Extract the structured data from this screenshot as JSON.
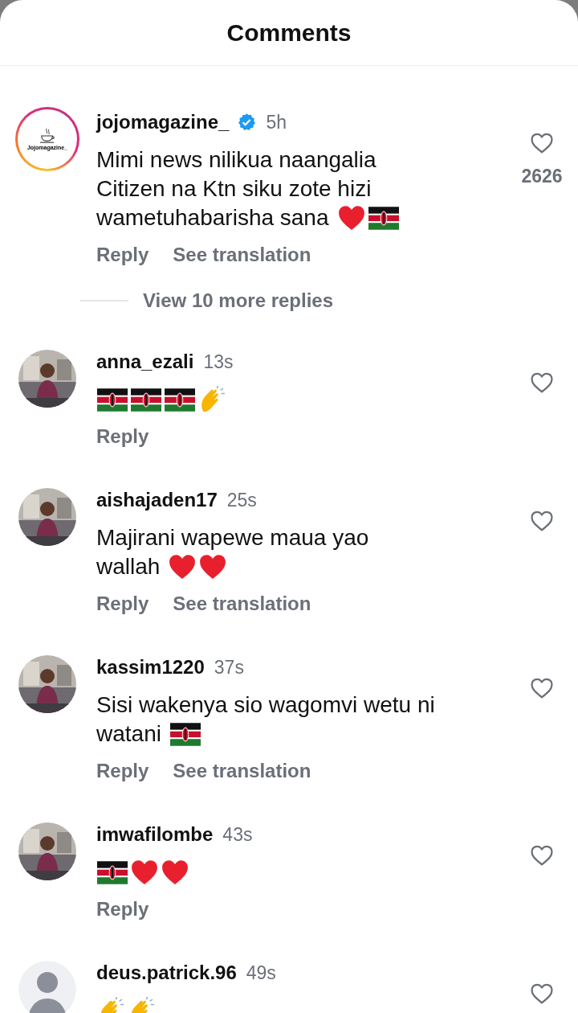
{
  "header": {
    "title": "Comments"
  },
  "comments": [
    {
      "username": "jojomagazine_",
      "verified": true,
      "time": "5h",
      "avatar": {
        "kind": "logo",
        "label": "Jojomagazine_"
      },
      "text_lines": [
        "Mimi news nilikua naangalia",
        "Citizen na Ktn siku zote hizi",
        "wametuhabarisha sana"
      ],
      "emoji": [
        {
          "kind": "heart"
        },
        {
          "kind": "flag"
        }
      ],
      "actions": [
        "Reply",
        "See translation"
      ],
      "likes": "2626",
      "more_replies": "View 10 more replies"
    },
    {
      "username": "anna_ezali",
      "verified": false,
      "time": "13s",
      "avatar": {
        "kind": "picture"
      },
      "emoji": [
        {
          "kind": "flag"
        },
        {
          "kind": "flag"
        },
        {
          "kind": "flag"
        },
        {
          "kind": "clap"
        }
      ],
      "actions": [
        "Reply"
      ]
    },
    {
      "username": "aishajaden17",
      "verified": false,
      "time": "25s",
      "avatar": {
        "kind": "picture"
      },
      "text_lines": [
        "Majirani wapewe maua yao",
        "wallah"
      ],
      "emoji": [
        {
          "kind": "heart"
        },
        {
          "kind": "heart"
        }
      ],
      "actions": [
        "Reply",
        "See translation"
      ]
    },
    {
      "username": "kassim1220",
      "verified": false,
      "time": "37s",
      "avatar": {
        "kind": "picture"
      },
      "text_lines": [
        "Sisi wakenya sio wagomvi wetu ni",
        "watani"
      ],
      "emoji": [
        {
          "kind": "flag"
        }
      ],
      "actions": [
        "Reply",
        "See translation"
      ]
    },
    {
      "username": "imwafilombe",
      "verified": false,
      "time": "43s",
      "avatar": {
        "kind": "picture"
      },
      "emoji": [
        {
          "kind": "flag"
        },
        {
          "kind": "heart"
        },
        {
          "kind": "heart"
        }
      ],
      "actions": [
        "Reply"
      ]
    },
    {
      "username": "deus.patrick.96",
      "verified": false,
      "time": "49s",
      "avatar": {
        "kind": "default"
      },
      "emoji": [
        {
          "kind": "clap"
        },
        {
          "kind": "clap"
        }
      ]
    }
  ]
}
